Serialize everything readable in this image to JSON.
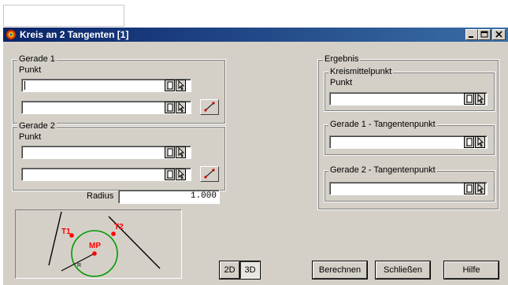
{
  "window": {
    "title": "Kreis an 2 Tangenten [1]"
  },
  "gerade1": {
    "label": "Gerade 1",
    "punkt_label": "Punkt",
    "field1_value": "",
    "field2_value": ""
  },
  "gerade2": {
    "label": "Gerade 2",
    "punkt_label": "Punkt",
    "field1_value": "",
    "field2_value": ""
  },
  "radius": {
    "label": "Radius",
    "value": "1.000"
  },
  "ergebnis": {
    "label": "Ergebnis",
    "kreismittelpunkt": {
      "label": "Kreismittelpunkt",
      "punkt_label": "Punkt",
      "value": ""
    },
    "tangentenpunkt1": {
      "label": "Gerade 1 - Tangentenpunkt",
      "value": ""
    },
    "tangentenpunkt2": {
      "label": "Gerade 2 - Tangentenpunkt",
      "value": ""
    }
  },
  "diagram": {
    "t1": "T1",
    "t2": "T2",
    "mp": "MP",
    "r": "R",
    "circle_color": "#009a00",
    "marker_color": "#ff0000"
  },
  "view_toggle": {
    "label_2d": "2D",
    "label_3d": "3D",
    "active": "3D"
  },
  "buttons": {
    "berechnen": "Berechnen",
    "schliessen": "Schließen",
    "hilfe": "Hilfe"
  },
  "colors": {
    "titlebar_start": "#0a246a",
    "titlebar_end": "#3a6ea5",
    "face": "#d4d0c8"
  }
}
